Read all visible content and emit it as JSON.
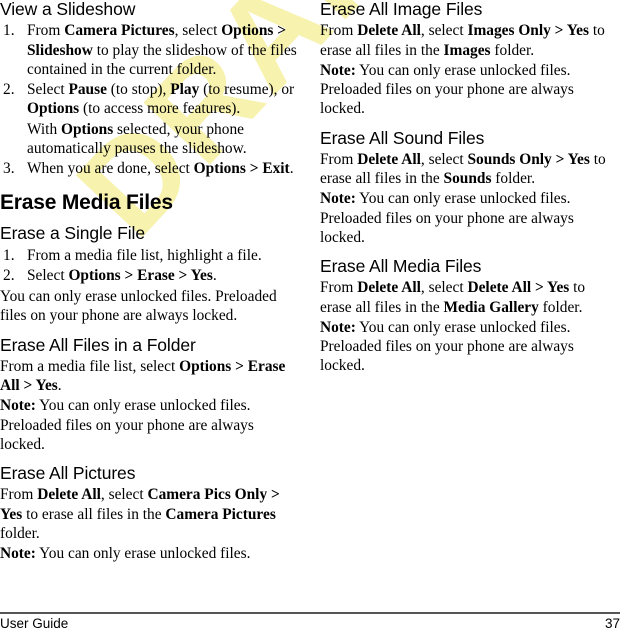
{
  "watermark": {
    "text": "DRAFT",
    "color": "#f7f2ad"
  },
  "footer": {
    "left_label": "User Guide",
    "page_number": "37"
  },
  "left_column": {
    "section_view_slideshow": {
      "heading": "View a Slideshow",
      "steps": [
        {
          "parts": [
            {
              "t": "From ",
              "b": false
            },
            {
              "t": "Camera Pictures",
              "b": true
            },
            {
              "t": ", select ",
              "b": false
            },
            {
              "t": "Options > Slideshow",
              "b": true
            },
            {
              "t": " to play the slideshow of the files contained in the current folder.",
              "b": false
            }
          ],
          "text": "From Camera Pictures, select Options > Slideshow to play the slideshow of the files contained in the current folder."
        },
        {
          "parts": [
            {
              "t": "Select ",
              "b": false
            },
            {
              "t": "Pause",
              "b": true
            },
            {
              "t": " (to stop), ",
              "b": false
            },
            {
              "t": "Play",
              "b": true
            },
            {
              "t": " (to resume), or ",
              "b": false
            },
            {
              "t": "Options",
              "b": true
            },
            {
              "t": " (to access more features).",
              "b": false
            }
          ],
          "text": "Select Pause (to stop), Play (to resume), or Options (to access more features).",
          "sub_text": "With Options selected, your phone automatically pauses the slideshow."
        },
        {
          "parts": [
            {
              "t": "When you are done, select ",
              "b": false
            },
            {
              "t": "Options > Exit",
              "b": true
            },
            {
              "t": ".",
              "b": false
            }
          ],
          "text": "When you are done, select Options > Exit."
        }
      ]
    },
    "section_erase_media_files": {
      "heading": "Erase Media Files"
    },
    "section_erase_single_file": {
      "heading": "Erase a Single File",
      "steps": [
        {
          "text": "From a media file list, highlight a file."
        },
        {
          "text": "Select Options > Erase > Yes."
        }
      ],
      "paragraph": "You can only erase unlocked files. Preloaded files on your phone are always locked."
    },
    "section_erase_all_folder": {
      "heading": "Erase All Files in a Folder",
      "paragraph": "From a media file list, select Options > Erase All > Yes.",
      "note_label": "Note:",
      "note": "You can only erase unlocked files. Preloaded files on your phone are always locked."
    },
    "section_erase_all_pictures": {
      "heading": "Erase All Pictures",
      "paragraph": "From Delete All, select Camera Pics Only > Yes to erase all files in the Camera Pictures folder.",
      "note_label": "Note:",
      "note": "You can only erase unlocked files."
    }
  },
  "right_column": {
    "section_erase_all_image_files": {
      "heading": "Erase All Image Files",
      "paragraph": "From Delete All, select Images Only > Yes to erase all files in the Images folder.",
      "note_label": "Note:",
      "note": "You can only erase unlocked files. Preloaded files on your phone are always locked."
    },
    "section_erase_all_sound_files": {
      "heading": "Erase All Sound Files",
      "paragraph": "From Delete All, select Sounds Only > Yes to erase all files in the Sounds folder.",
      "note_label": "Note:",
      "note": "You can only erase unlocked files. Preloaded files on your phone are always locked."
    },
    "section_erase_all_media_files": {
      "heading": "Erase All Media Files",
      "paragraph": "From Delete All, select Delete All > Yes to erase all files in the Media Gallery folder.",
      "note_label": "Note:",
      "note": "You can only erase unlocked files. Preloaded files on your phone are always locked."
    }
  },
  "inline_bold_terms": [
    "Camera Pictures",
    "Options > Slideshow",
    "Pause",
    "Play",
    "Options",
    "Options > Exit",
    "Options > Erase > Yes",
    "Options > Erase All > Yes",
    "Delete All",
    "Camera Pics Only > Yes",
    "Camera Pictures",
    "Images Only > Yes",
    "Images",
    "Sounds Only > Yes",
    "Sounds",
    "Delete All > Yes",
    "Media Gallery",
    "Note:"
  ]
}
